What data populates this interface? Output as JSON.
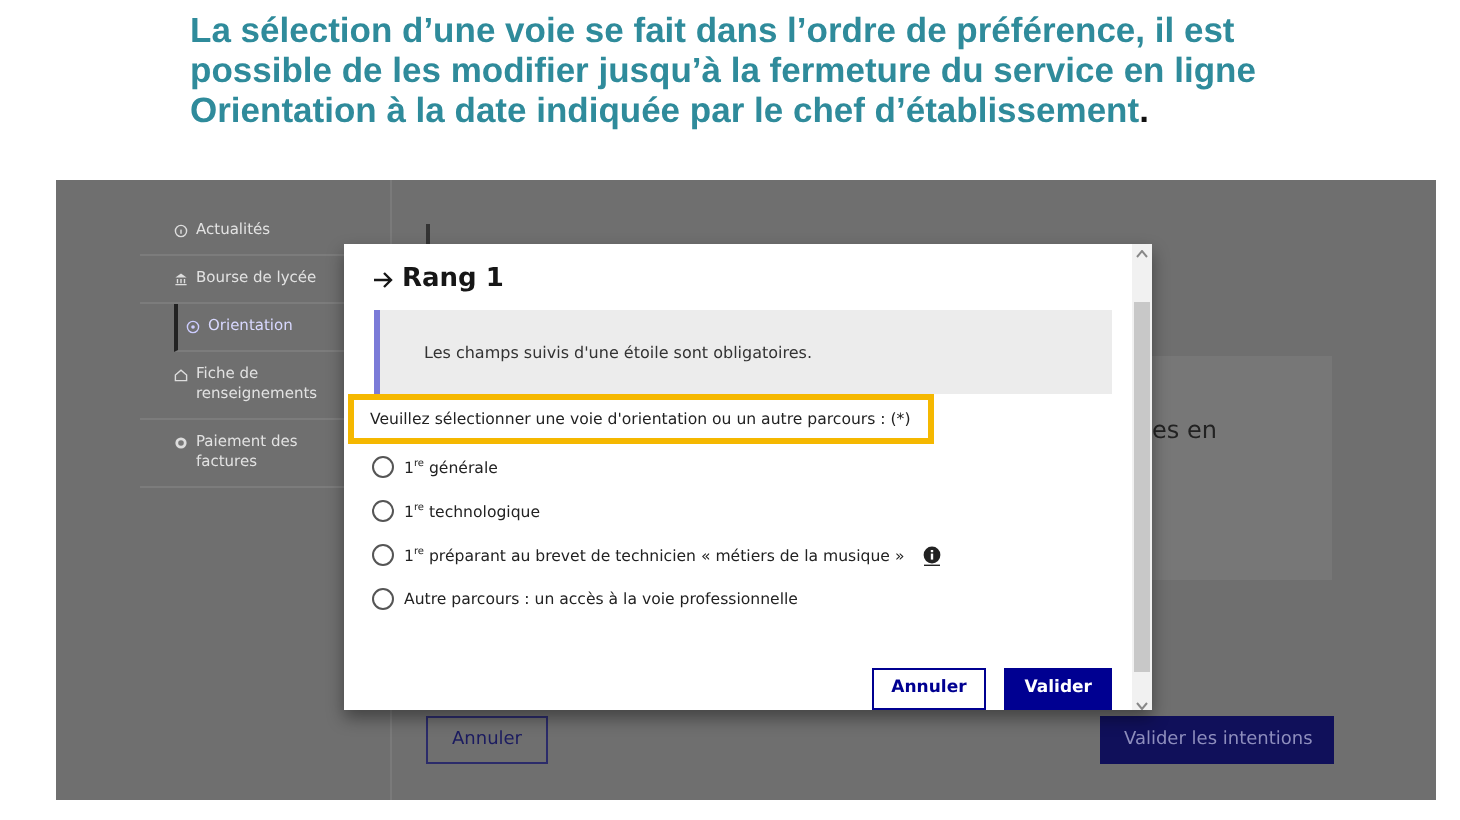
{
  "slide_title": {
    "text": "La sélection d’une voie se fait dans l’ordre de préférence, il est possible de les modifier jusqu’à la fermeture du service en ligne Orientation à la date indiquée par le chef d’établissement",
    "end_mark": "."
  },
  "sidebar": {
    "items": [
      {
        "label": "Actualités",
        "selected": false
      },
      {
        "label": "Bourse de lycée",
        "selected": false
      },
      {
        "label": "Orientation",
        "selected": true
      },
      {
        "label": "Fiche de renseignements",
        "selected": false
      },
      {
        "label": "Paiement des factures",
        "selected": false
      }
    ]
  },
  "page": {
    "card_text": "es en",
    "buttons": [
      {
        "label": "Annuler",
        "kind": "secondary"
      },
      {
        "label": "Valider les intentions",
        "kind": "primary"
      }
    ]
  },
  "modal": {
    "title": "Rang 1",
    "notice": "Les champs suivis d'une étoile sont obligatoires.",
    "question": "Veuillez sélectionner une voie d'orientation ou un autre parcours : (*)",
    "options": [
      {
        "label": "1$^{re}$ générale",
        "selected": false,
        "info": false
      },
      {
        "label": "1$^{re}$ technologique",
        "selected": false,
        "info": false
      },
      {
        "label": "1$^{re}$ préparant au brevet de technicien « métiers de la musique »",
        "selected": false,
        "info": true
      },
      {
        "label": "Autre parcours : un accès à la voie professionnelle",
        "selected": false,
        "info": false
      }
    ],
    "buttons": [
      {
        "label": "Annuler",
        "kind": "secondary"
      },
      {
        "label": "Valider",
        "kind": "primary"
      }
    ]
  }
}
